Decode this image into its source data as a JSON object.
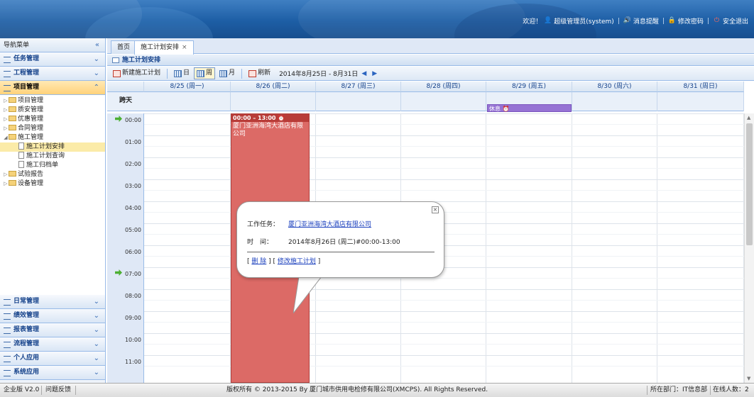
{
  "header": {
    "welcome": "欢迎！",
    "user": "超级管理员(system)",
    "links": [
      "消息提醒",
      "修改密码",
      "安全退出"
    ]
  },
  "sidebar": {
    "title": "导航菜单",
    "top_groups": [
      "任务管理",
      "工程管理",
      "项目管理"
    ],
    "tree": [
      {
        "label": "项目管理",
        "level": 0,
        "type": "folder"
      },
      {
        "label": "质安管理",
        "level": 0,
        "type": "folder"
      },
      {
        "label": "优惠管理",
        "level": 0,
        "type": "folder"
      },
      {
        "label": "合同管理",
        "level": 0,
        "type": "folder"
      },
      {
        "label": "施工管理",
        "level": 0,
        "type": "folder",
        "open": true
      },
      {
        "label": "施工计划安排",
        "level": 1,
        "type": "doc",
        "selected": true
      },
      {
        "label": "施工计划查询",
        "level": 1,
        "type": "doc"
      },
      {
        "label": "施工归档单",
        "level": 1,
        "type": "doc"
      },
      {
        "label": "试验报告",
        "level": 0,
        "type": "folder"
      },
      {
        "label": "设备管理",
        "level": 0,
        "type": "folder"
      }
    ],
    "bottom_groups": [
      "日常管理",
      "绩效管理",
      "报表管理",
      "流程管理",
      "个人应用",
      "系统应用"
    ]
  },
  "tabs": [
    {
      "label": "首页",
      "closable": false
    },
    {
      "label": "施工计划安排",
      "closable": true,
      "active": true
    }
  ],
  "panel_title": "施工计划安排",
  "toolbar": {
    "new_plan": "新建施工计划",
    "day": "日",
    "week": "周",
    "month": "月",
    "refresh": "刷新",
    "range": "2014年8月25日 - 8月31日",
    "active_view": "week"
  },
  "calendar": {
    "days": [
      "8/25 (周一)",
      "8/26 (周二)",
      "8/27 (周三)",
      "8/28 (周四)",
      "8/29 (周五)",
      "8/30 (周六)",
      "8/31 (周日)"
    ],
    "allday_label": "跨天",
    "hours": [
      "00:00",
      "01:00",
      "02:00",
      "03:00",
      "04:00",
      "05:00",
      "06:00",
      "07:00",
      "08:00",
      "09:00",
      "10:00",
      "11:00"
    ],
    "allday_events": [
      {
        "day_index": 4,
        "label": "休息",
        "color": "#9673d4"
      }
    ],
    "events": [
      {
        "day_index": 1,
        "time": "00:00 – 13:00",
        "title": "厦门亚洲海湾大酒店有限公司",
        "color": "#dc6a66"
      }
    ]
  },
  "popup": {
    "task_label": "工作任务：",
    "task_value": "厦门亚洲海湾大酒店有限公司",
    "time_label": "时　间：",
    "time_value": "2014年8月26日 (周二)#00:00-13:00",
    "delete_link": "删 除",
    "edit_link": "修改施工计划"
  },
  "footer": {
    "version": "企业版 V2.0",
    "feedback": "问题反馈",
    "copyright": "版权所有 © 2013-2015 By 厦门城市供用电检修有限公司(XMCPS). All Rights Reserved.",
    "department": "所在部门：IT信息部",
    "online": "在线人数：2"
  }
}
